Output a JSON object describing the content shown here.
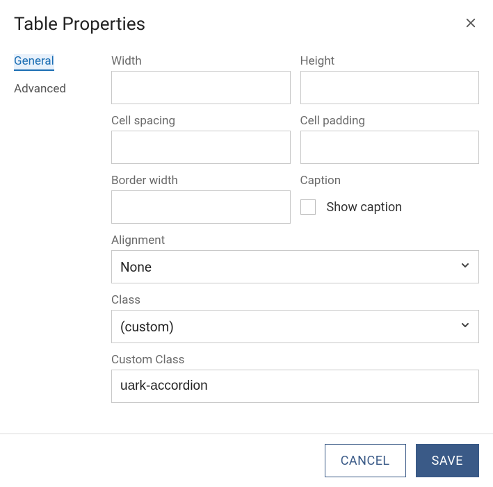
{
  "dialog": {
    "title": "Table Properties"
  },
  "tabs": {
    "general": "General",
    "advanced": "Advanced"
  },
  "form": {
    "width_label": "Width",
    "width_value": "",
    "height_label": "Height",
    "height_value": "",
    "cellspacing_label": "Cell spacing",
    "cellspacing_value": "",
    "cellpadding_label": "Cell padding",
    "cellpadding_value": "",
    "borderwidth_label": "Border width",
    "borderwidth_value": "",
    "caption_label": "Caption",
    "showcaption_label": "Show caption",
    "alignment_label": "Alignment",
    "alignment_value": "None",
    "class_label": "Class",
    "class_value": "(custom)",
    "customclass_label": "Custom Class",
    "customclass_value": "uark-accordion"
  },
  "buttons": {
    "cancel": "CANCEL",
    "save": "SAVE"
  }
}
